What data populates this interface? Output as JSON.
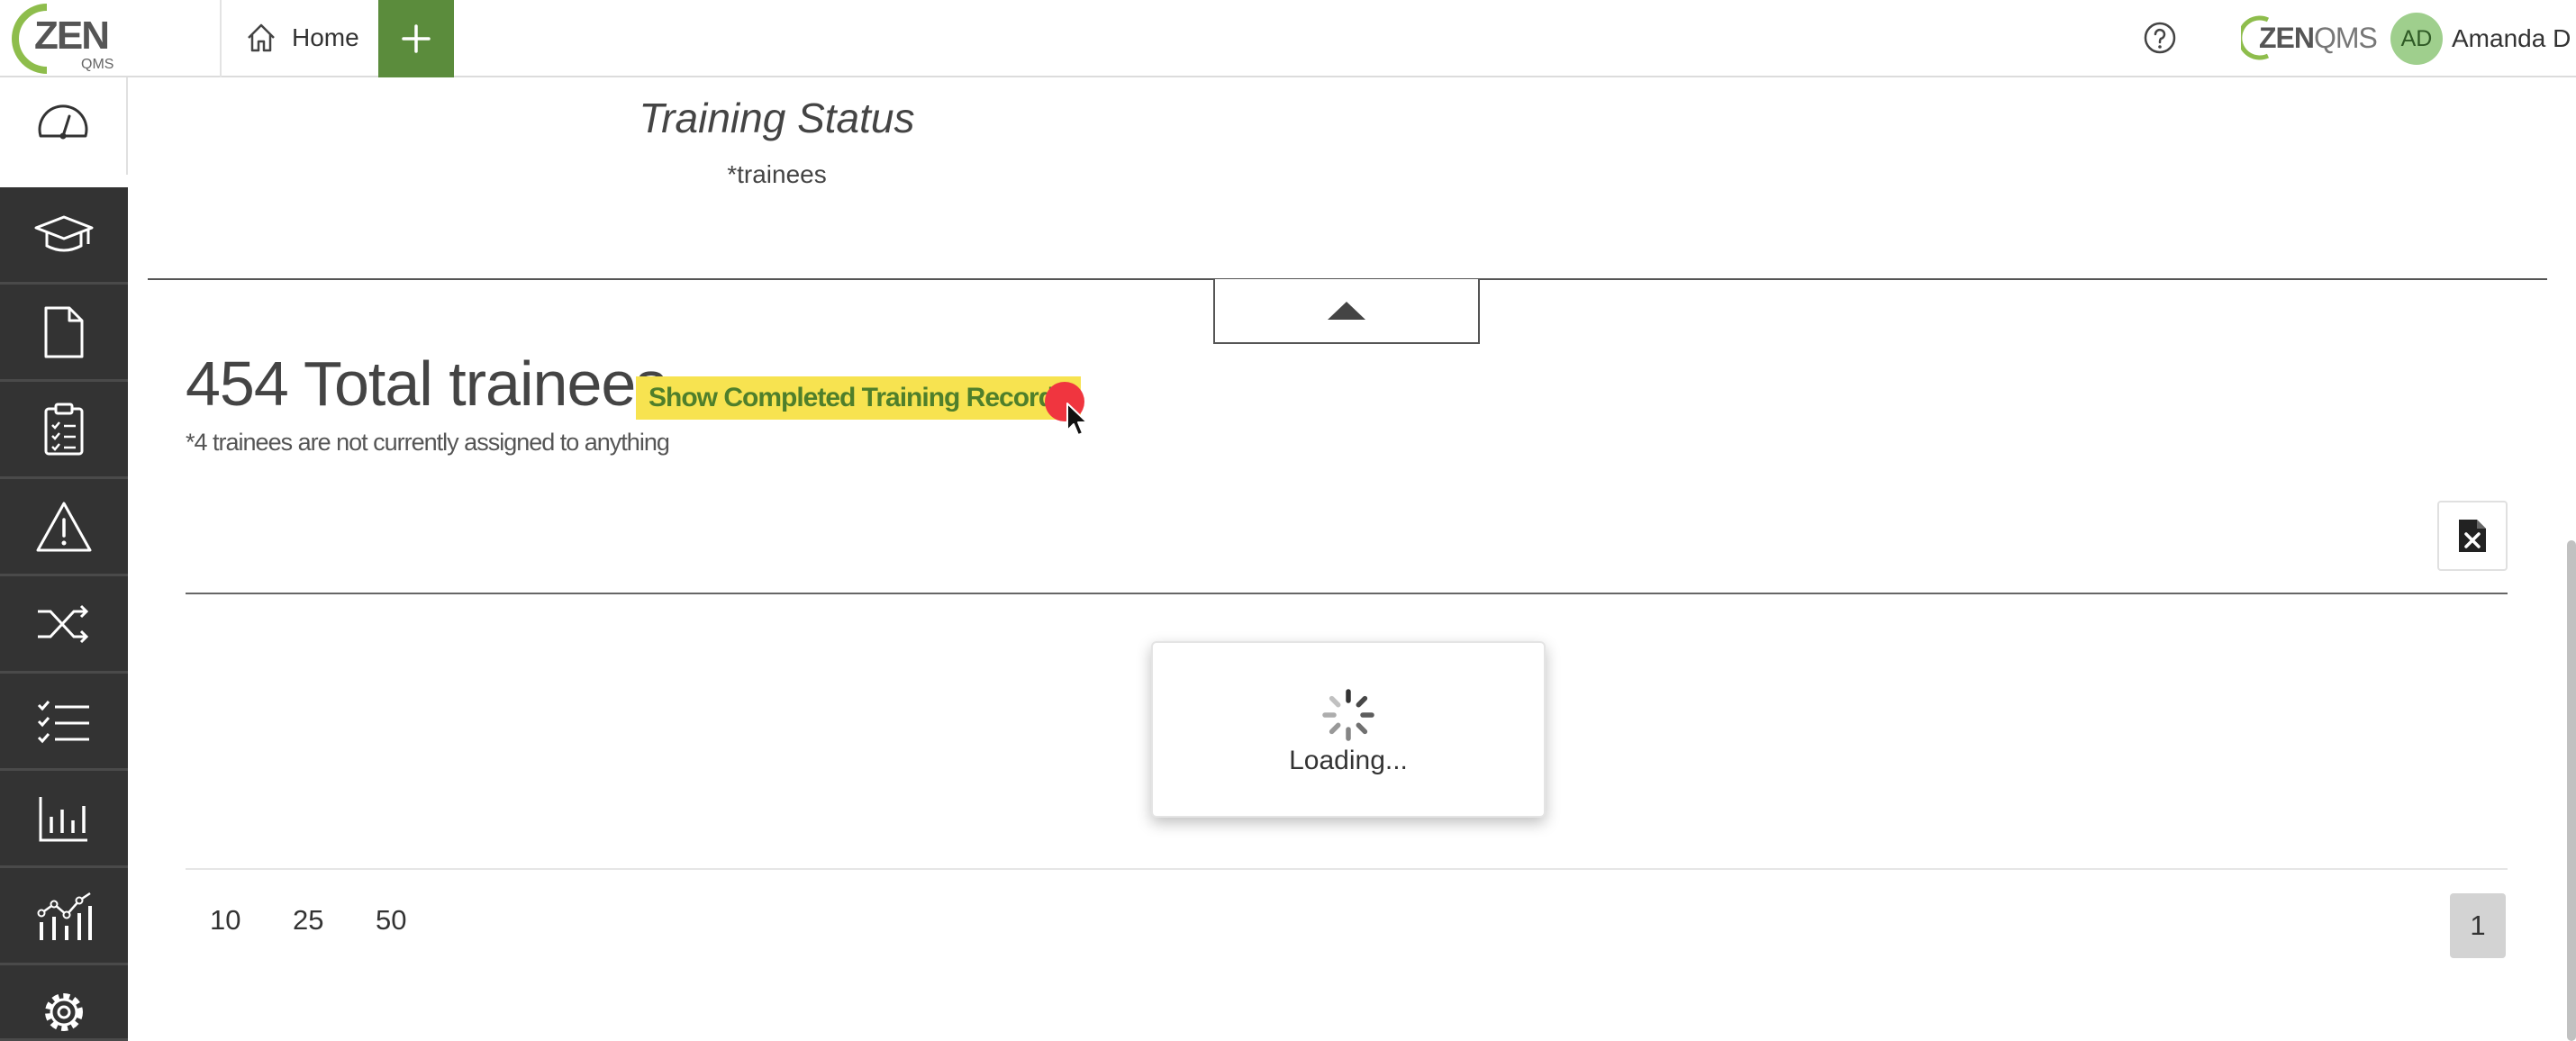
{
  "header": {
    "logo_text": "ZEN",
    "logo_subtext": "QMS",
    "home_label": "Home",
    "brand_part1": "ZEN",
    "brand_part2": "QMS",
    "user_initials": "AD",
    "user_name": "Amanda D"
  },
  "sidebar": {
    "items": [
      {
        "name": "dashboard",
        "icon": "gauge-icon"
      },
      {
        "name": "training",
        "icon": "graduation-cap-icon"
      },
      {
        "name": "documents",
        "icon": "document-icon"
      },
      {
        "name": "audits",
        "icon": "clipboard-checklist-icon"
      },
      {
        "name": "risks",
        "icon": "warning-triangle-icon"
      },
      {
        "name": "change-control",
        "icon": "shuffle-icon"
      },
      {
        "name": "checklists",
        "icon": "checklist-icon"
      },
      {
        "name": "reports",
        "icon": "bar-chart-icon"
      },
      {
        "name": "analytics",
        "icon": "line-bar-chart-icon"
      },
      {
        "name": "settings",
        "icon": "gear-icon"
      }
    ]
  },
  "main": {
    "section_title": "Training Status",
    "section_subtitle": "*trainees",
    "total_title": "454 Total trainees",
    "show_completed_label": "Show Completed Training Records",
    "unassigned_note": "*4 trainees are not currently assigned to anything",
    "loading_text": "Loading...",
    "page_sizes": [
      "10",
      "25",
      "50"
    ],
    "current_page": "1"
  },
  "colors": {
    "accent_green": "#5b8c3c",
    "sidebar_dark": "#333333",
    "highlight_yellow": "#f7e350",
    "cursor_dot": "#f0353f"
  }
}
